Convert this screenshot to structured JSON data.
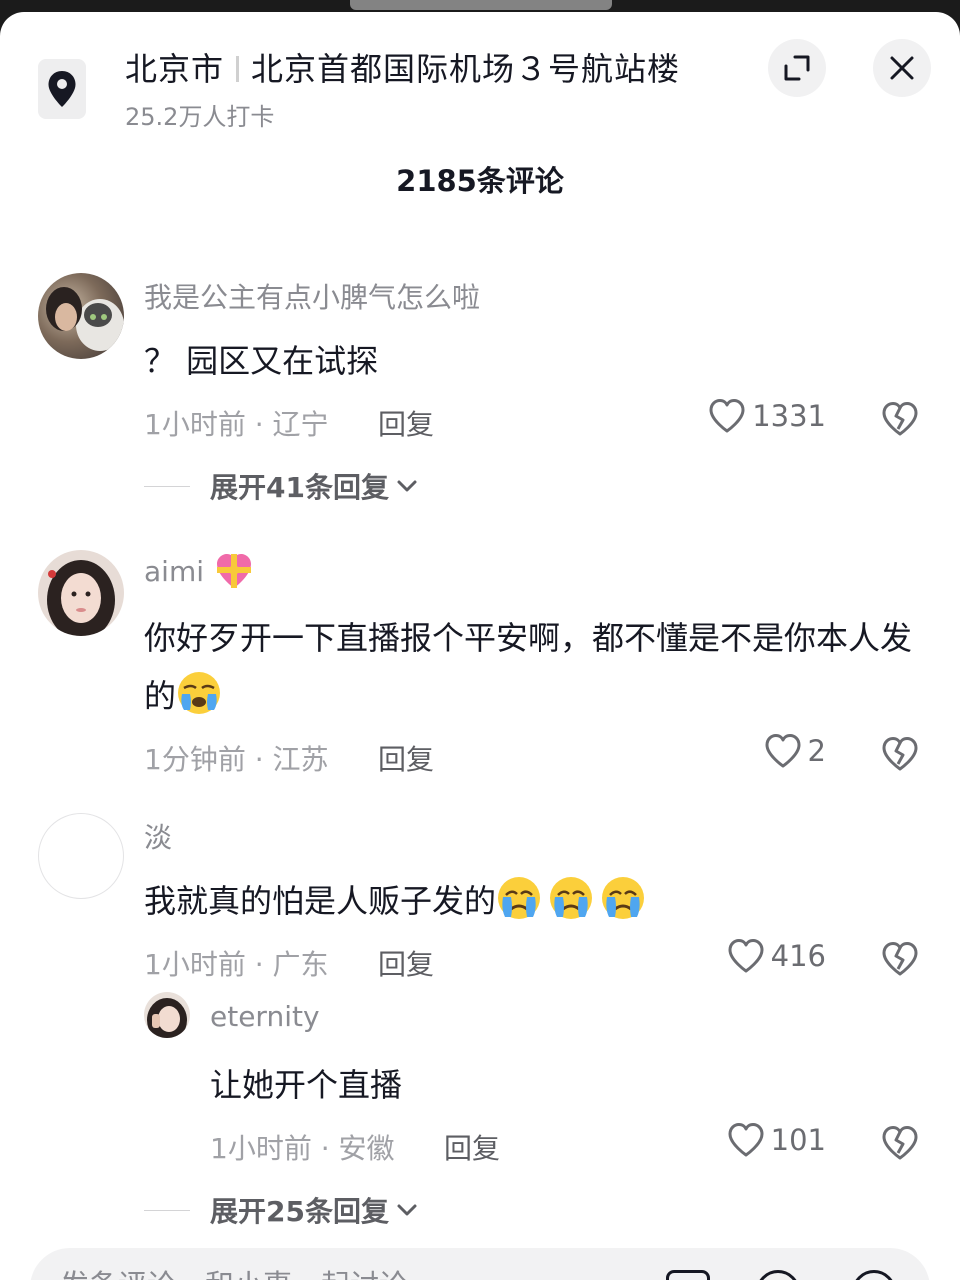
{
  "header": {
    "city": "北京市",
    "place": "北京首都国际机场３号航站楼",
    "checkins": "25.2万人打卡",
    "comment_count": "2185条评论"
  },
  "comments": [
    {
      "user": "我是公主有点小脾气怎么啦",
      "text": "？ 园区又在试探",
      "time_loc": "1小时前 · 辽宁",
      "reply_label": "回复",
      "likes": "1331",
      "expand": "展开41条回复"
    },
    {
      "user": "aimi",
      "user_badge": "heart-gift-emoji",
      "text": "你好歹开一下直播报个平安啊，都不懂是不是你本人发的",
      "text_emoji": "crying-face",
      "time_loc": "1分钟前 · 江苏",
      "reply_label": "回复",
      "likes": "2"
    },
    {
      "user": "淡",
      "text": "我就真的怕是人贩子发的",
      "text_emoji": "crying-face x3",
      "time_loc": "1小时前 · 广东",
      "reply_label": "回复",
      "likes": "416",
      "reply": {
        "user": "eternity",
        "text": "让她开个直播",
        "time_loc": "1小时前 · 安徽",
        "reply_label": "回复",
        "likes": "101"
      },
      "expand": "展开25条回复"
    }
  ],
  "input": {
    "placeholder": "发条评论，和小事一起讨论"
  },
  "colors": {
    "text": "#161823",
    "secondary": "#8a8b91",
    "sheet": "#ffffff"
  }
}
